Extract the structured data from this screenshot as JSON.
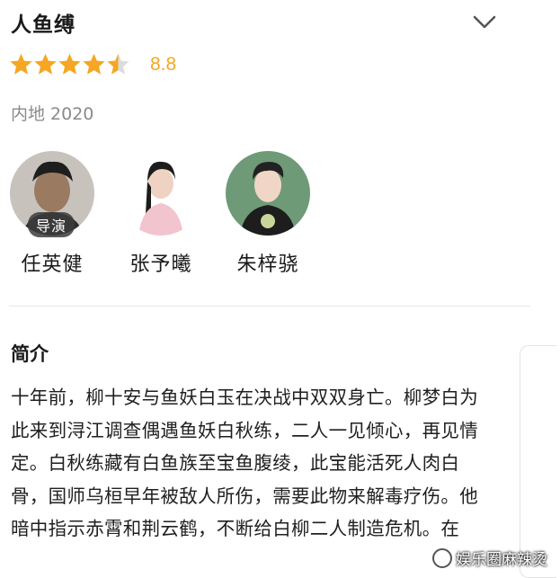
{
  "movie": {
    "title": "人鱼缚",
    "rating": 8.8,
    "rating_text": "8.8",
    "stars": 4.5,
    "meta": "内地 2020"
  },
  "cast": [
    {
      "name": "任英健",
      "badge": "导演"
    },
    {
      "name": "张予曦",
      "badge": ""
    },
    {
      "name": "朱梓骁",
      "badge": ""
    }
  ],
  "synopsis": {
    "heading": "简介",
    "lines": [
      "十年前，柳十安与鱼妖白玉在决战中双双身亡。柳梦白为",
      "此来到浔江调查偶遇鱼妖白秋练，二人一见倾心，再见情",
      "定。白秋练藏有白鱼族至宝鱼腹绫，此宝能活死人肉白",
      "骨，国师乌桓早年被敌人所伤，需要此物来解毒疗伤。他",
      "暗中指示赤霄和荆云鹤，不断给白柳二人制造危机。在"
    ]
  },
  "watermark": "娱乐圈麻辣烫",
  "colors": {
    "star": "#f5a623",
    "star_empty": "#dcdcdc",
    "meta": "#8a8a8a"
  },
  "icons": {
    "expand": "chevron-down-icon",
    "star": "star-icon"
  }
}
